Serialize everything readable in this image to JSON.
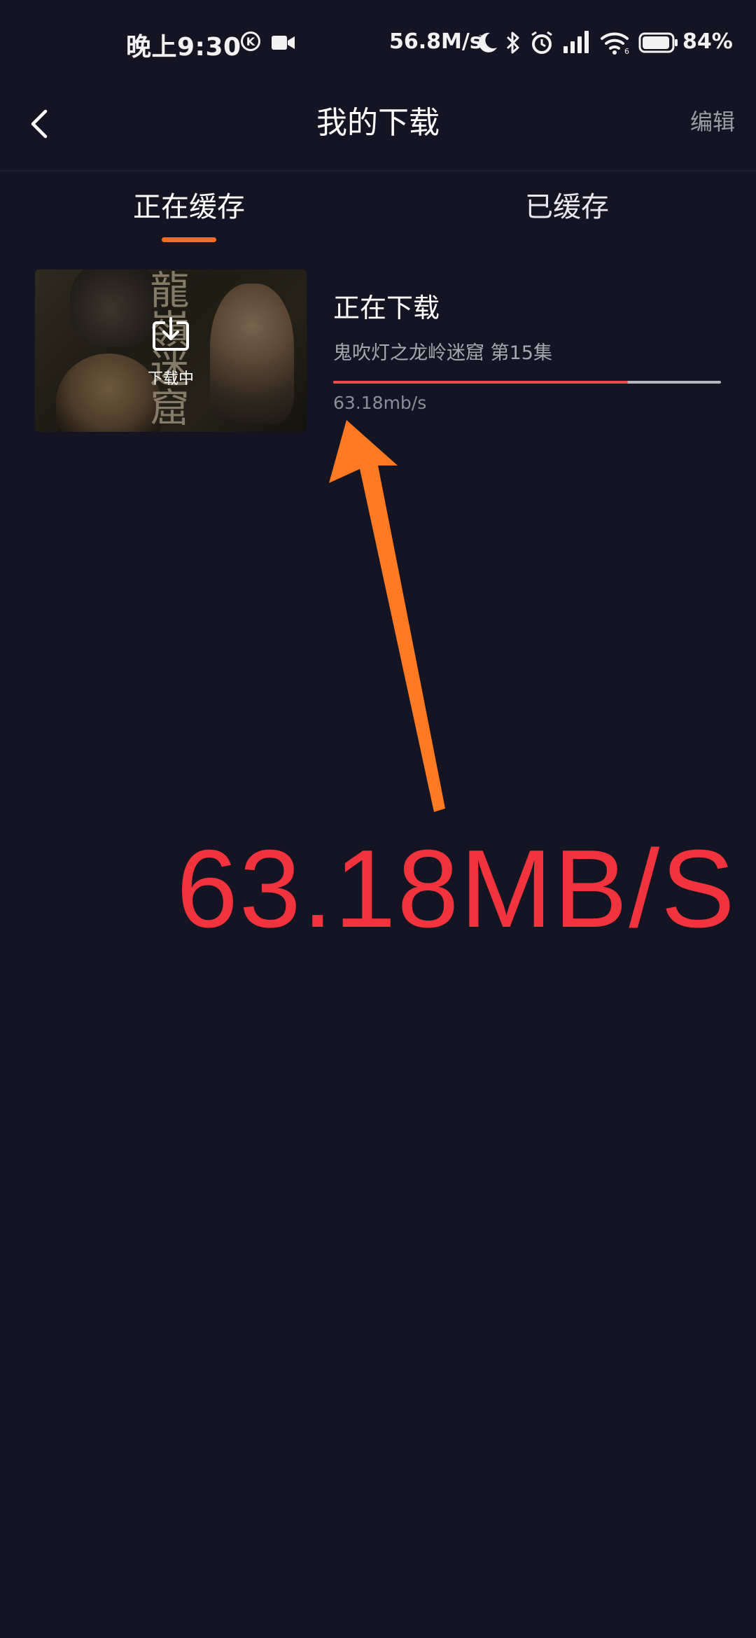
{
  "status_bar": {
    "time": "晚上9:30",
    "k_badge": "K",
    "network_speed": "56.8M/s",
    "battery_percent": "84%",
    "icons": [
      "k-circle-icon",
      "video-camera-icon",
      "moon-icon",
      "bluetooth-icon",
      "alarm-icon",
      "signal-icon",
      "wifi-icon",
      "battery-icon"
    ]
  },
  "header": {
    "title": "我的下载",
    "edit_label": "编辑",
    "back_icon": "chevron-left-icon"
  },
  "tabs": [
    {
      "label": "正在缓存",
      "active": true
    },
    {
      "label": "已缓存",
      "active": false
    }
  ],
  "downloads": [
    {
      "status": "正在下载",
      "title": "鬼吹灯之龙岭迷窟  第15集",
      "thumbnail_status": "下载中",
      "thumbnail_art_text": "龍嶺迷窟",
      "speed": "63.18mb/s",
      "progress": 0.76
    }
  ],
  "annotation": {
    "text": "63.18MB/S",
    "text_color": "#f0333c",
    "arrow_color": "#ff7a22"
  },
  "colors": {
    "background": "#141422",
    "accent": "#ff6a21",
    "progress_fill": "#ec4a4e",
    "progress_track": "#b6b6c0"
  }
}
